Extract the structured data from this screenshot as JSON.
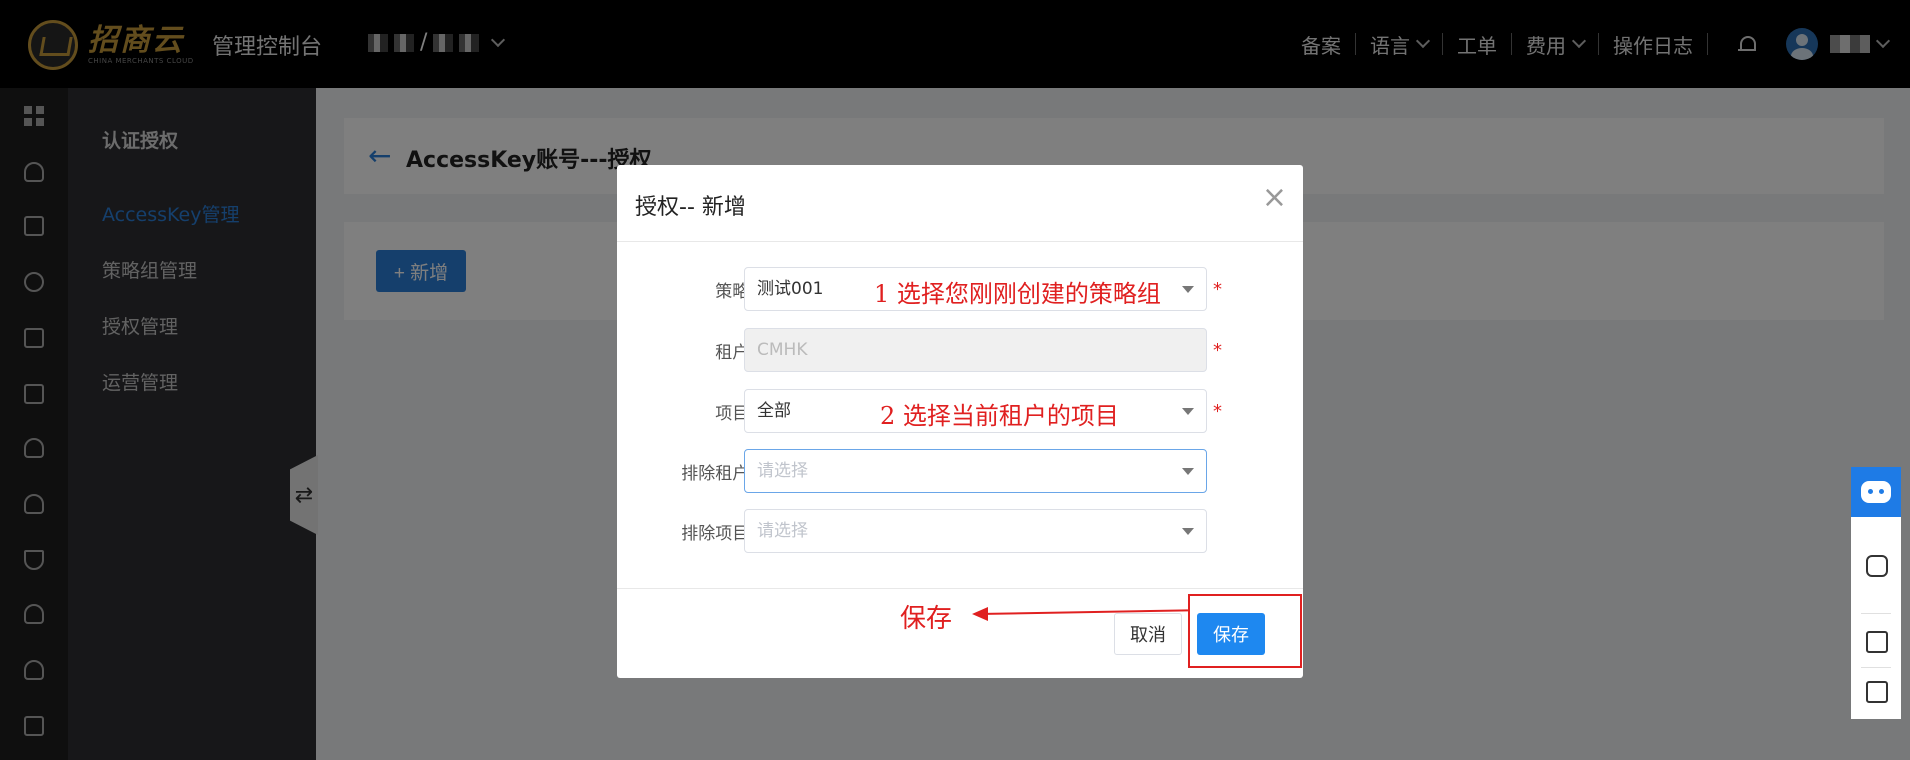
{
  "topbar": {
    "logo_cn": "招商云",
    "logo_en": "CHINA MERCHANTS CLOUD",
    "console_title": "管理控制台",
    "tenant_separator": "/",
    "nav": [
      "备案",
      "语言",
      "工单",
      "费用",
      "操作日志"
    ]
  },
  "sidemenu": {
    "title": "认证授权",
    "items": [
      "AccessKey管理",
      "策略组管理",
      "授权管理",
      "运营管理"
    ],
    "active_index": 0,
    "collapse_symbol": "⇄"
  },
  "page": {
    "back_symbol": "←",
    "title": "AccessKey账号---授权",
    "add_button": "+ 新增"
  },
  "modal": {
    "title": "授权-- 新增",
    "close_symbol": "×",
    "fields": [
      {
        "label": "策略:",
        "value": "测试001",
        "required": true
      },
      {
        "label": "租户:",
        "value": "CMHK",
        "required": true
      },
      {
        "label": "项目:",
        "value": "全部",
        "required": true
      },
      {
        "label": "排除租户:",
        "placeholder": "请选择",
        "required": false
      },
      {
        "label": "排除项目:",
        "placeholder": "请选择",
        "required": false
      }
    ],
    "required_mark": "*",
    "cancel_label": "取消",
    "save_label": "保存"
  },
  "annotations": {
    "policy_hint": "1  选择您刚刚创建的策略组",
    "project_hint": "2  选择当前租户的项目",
    "save_hint": "保存"
  },
  "colors": {
    "accent": "#2a7fd9",
    "annotation": "#e02020",
    "topbar": "#000000",
    "sidemenu": "#2e2f33"
  }
}
